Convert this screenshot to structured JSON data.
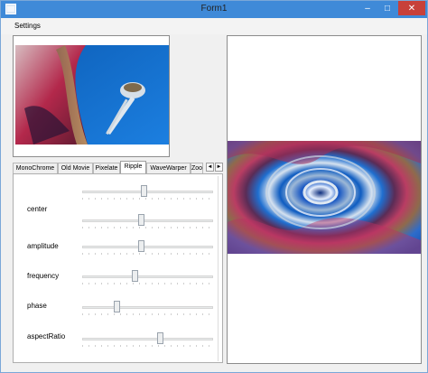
{
  "window": {
    "title": "Form1",
    "controls": {
      "minimize": "–",
      "maximize": "□",
      "close": "✕"
    },
    "titlebar_color": "#3f8ad8",
    "close_color": "#c7413a"
  },
  "menu": {
    "items": [
      "Settings"
    ]
  },
  "tabs": {
    "items": [
      "MonoChrome",
      "Old Movie",
      "Pixelate",
      "Ripple",
      "WaveWarper",
      "Zoo"
    ],
    "active": "Ripple",
    "scroll_left": "◄",
    "scroll_right": "►"
  },
  "ripple": {
    "params": [
      {
        "label": "center",
        "sliders": [
          0.47,
          0.45
        ]
      },
      {
        "label": "amplitude",
        "sliders": [
          0.45
        ]
      },
      {
        "label": "frequency",
        "sliders": [
          0.4
        ]
      },
      {
        "label": "phase",
        "sliders": [
          0.25
        ]
      },
      {
        "label": "aspectRatio",
        "sliders": [
          0.6
        ]
      }
    ]
  },
  "images": {
    "thumbnail_icon": "space-needle-photo",
    "output_icon": "rippled-photo"
  }
}
